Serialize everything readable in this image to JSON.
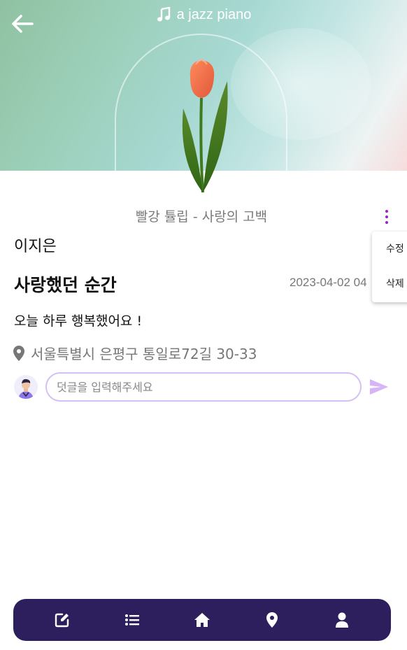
{
  "header": {
    "music_title": "a jazz piano",
    "back_icon": "arrow-left-icon",
    "music_icon": "music-note-icon"
  },
  "flower": {
    "title": "빨강 튤립 - 사랑의 고백",
    "image": "tulip-illustration"
  },
  "menu": {
    "icon": "more-vertical-icon",
    "items": [
      {
        "label": "수정"
      },
      {
        "label": "삭제"
      }
    ]
  },
  "post": {
    "author": "이지은",
    "title": "사랑했던 순간",
    "date": "2023-04-02 04",
    "body": "오늘 하루 행복했어요 !",
    "location": "서울특별시 은평구 통일로72길 30-33",
    "location_icon": "map-pin-icon"
  },
  "comment": {
    "placeholder": "덧글을 입력해주세요",
    "value": "",
    "send_icon": "send-icon",
    "avatar_icon": "user-avatar"
  },
  "nav": {
    "items": [
      {
        "icon": "edit-icon"
      },
      {
        "icon": "list-icon"
      },
      {
        "icon": "home-icon"
      },
      {
        "icon": "location-pin-icon"
      },
      {
        "icon": "user-icon"
      }
    ]
  },
  "colors": {
    "accent": "#a020c8",
    "nav_background": "#2d1f5e",
    "input_border": "#d6bff5",
    "send": "#d6b4f5",
    "muted_text": "#777777"
  }
}
